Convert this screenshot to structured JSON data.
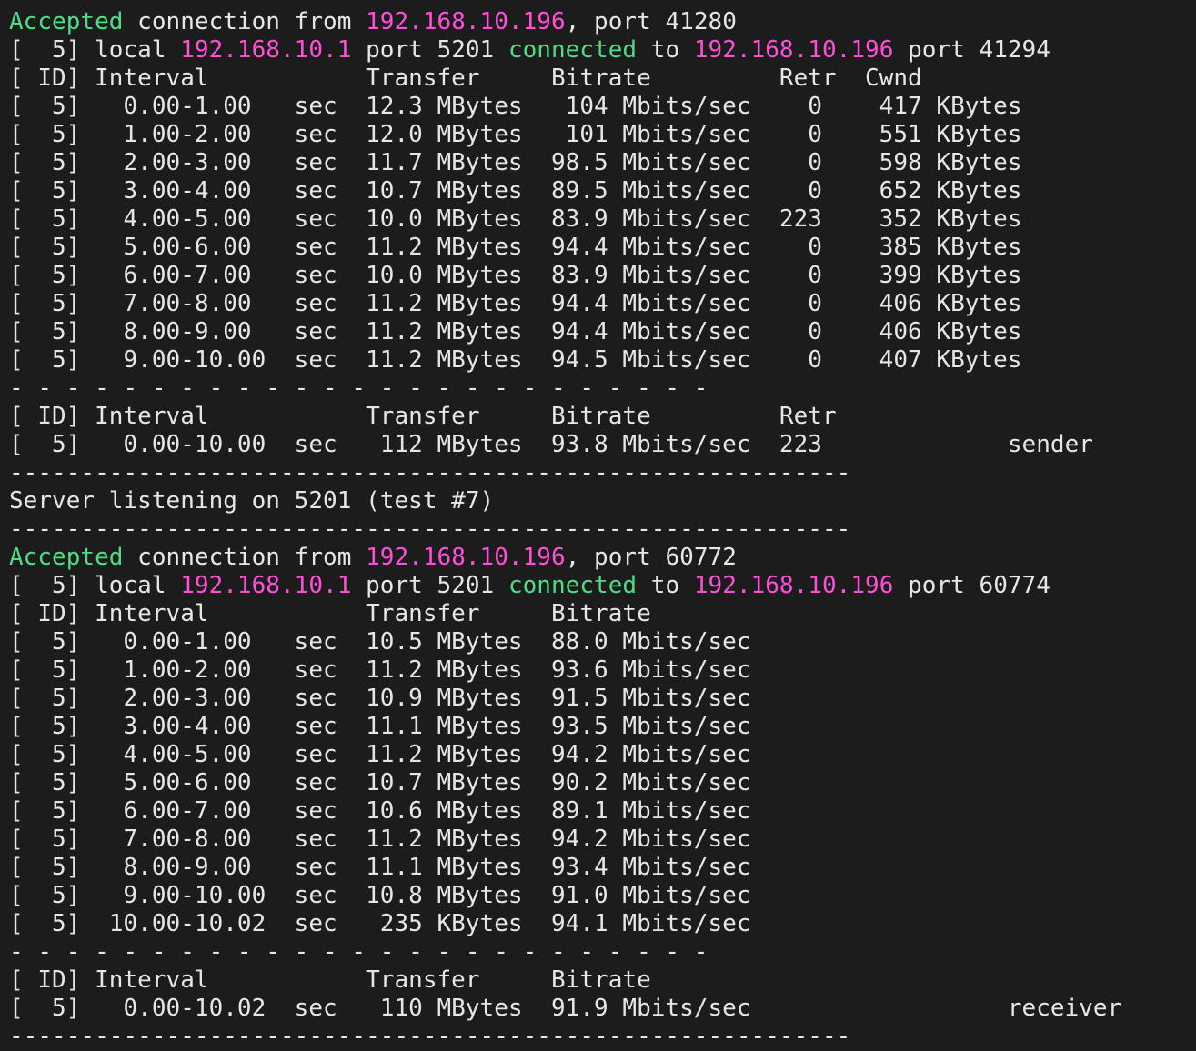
{
  "terminal": {
    "lines": [
      [
        [
          "g",
          "Accepted"
        ],
        [
          "w",
          " connection from "
        ],
        [
          "m",
          "192.168.10.196"
        ],
        [
          "w",
          ", port 41280"
        ]
      ],
      [
        [
          "w",
          "[  5] local "
        ],
        [
          "m",
          "192.168.10.1"
        ],
        [
          "w",
          " port 5201 "
        ],
        [
          "g",
          "connected"
        ],
        [
          "w",
          " to "
        ],
        [
          "m",
          "192.168.10.196"
        ],
        [
          "w",
          " port 41294"
        ]
      ],
      [
        [
          "w",
          "[ ID] Interval           Transfer     Bitrate         Retr  Cwnd"
        ]
      ],
      [
        [
          "w",
          "[  5]   0.00-1.00   sec  12.3 MBytes   104 Mbits/sec    0    417 KBytes"
        ]
      ],
      [
        [
          "w",
          "[  5]   1.00-2.00   sec  12.0 MBytes   101 Mbits/sec    0    551 KBytes"
        ]
      ],
      [
        [
          "w",
          "[  5]   2.00-3.00   sec  11.7 MBytes  98.5 Mbits/sec    0    598 KBytes"
        ]
      ],
      [
        [
          "w",
          "[  5]   3.00-4.00   sec  10.7 MBytes  89.5 Mbits/sec    0    652 KBytes"
        ]
      ],
      [
        [
          "w",
          "[  5]   4.00-5.00   sec  10.0 MBytes  83.9 Mbits/sec  223    352 KBytes"
        ]
      ],
      [
        [
          "w",
          "[  5]   5.00-6.00   sec  11.2 MBytes  94.4 Mbits/sec    0    385 KBytes"
        ]
      ],
      [
        [
          "w",
          "[  5]   6.00-7.00   sec  10.0 MBytes  83.9 Mbits/sec    0    399 KBytes"
        ]
      ],
      [
        [
          "w",
          "[  5]   7.00-8.00   sec  11.2 MBytes  94.4 Mbits/sec    0    406 KBytes"
        ]
      ],
      [
        [
          "w",
          "[  5]   8.00-9.00   sec  11.2 MBytes  94.4 Mbits/sec    0    406 KBytes"
        ]
      ],
      [
        [
          "w",
          "[  5]   9.00-10.00  sec  11.2 MBytes  94.5 Mbits/sec    0    407 KBytes"
        ]
      ],
      [
        [
          "w",
          "- - - - - - - - - - - - - - - - - - - - - - - - -"
        ]
      ],
      [
        [
          "w",
          "[ ID] Interval           Transfer     Bitrate         Retr"
        ]
      ],
      [
        [
          "w",
          "[  5]   0.00-10.00  sec   112 MBytes  93.8 Mbits/sec  223             sender"
        ]
      ],
      [
        [
          "w",
          "-----------------------------------------------------------"
        ]
      ],
      [
        [
          "w",
          "Server listening on 5201 (test #7)"
        ]
      ],
      [
        [
          "w",
          "-----------------------------------------------------------"
        ]
      ],
      [
        [
          "g",
          "Accepted"
        ],
        [
          "w",
          " connection from "
        ],
        [
          "m",
          "192.168.10.196"
        ],
        [
          "w",
          ", port 60772"
        ]
      ],
      [
        [
          "w",
          "[  5] local "
        ],
        [
          "m",
          "192.168.10.1"
        ],
        [
          "w",
          " port 5201 "
        ],
        [
          "g",
          "connected"
        ],
        [
          "w",
          " to "
        ],
        [
          "m",
          "192.168.10.196"
        ],
        [
          "w",
          " port 60774"
        ]
      ],
      [
        [
          "w",
          "[ ID] Interval           Transfer     Bitrate"
        ]
      ],
      [
        [
          "w",
          "[  5]   0.00-1.00   sec  10.5 MBytes  88.0 Mbits/sec"
        ]
      ],
      [
        [
          "w",
          "[  5]   1.00-2.00   sec  11.2 MBytes  93.6 Mbits/sec"
        ]
      ],
      [
        [
          "w",
          "[  5]   2.00-3.00   sec  10.9 MBytes  91.5 Mbits/sec"
        ]
      ],
      [
        [
          "w",
          "[  5]   3.00-4.00   sec  11.1 MBytes  93.5 Mbits/sec"
        ]
      ],
      [
        [
          "w",
          "[  5]   4.00-5.00   sec  11.2 MBytes  94.2 Mbits/sec"
        ]
      ],
      [
        [
          "w",
          "[  5]   5.00-6.00   sec  10.7 MBytes  90.2 Mbits/sec"
        ]
      ],
      [
        [
          "w",
          "[  5]   6.00-7.00   sec  10.6 MBytes  89.1 Mbits/sec"
        ]
      ],
      [
        [
          "w",
          "[  5]   7.00-8.00   sec  11.2 MBytes  94.2 Mbits/sec"
        ]
      ],
      [
        [
          "w",
          "[  5]   8.00-9.00   sec  11.1 MBytes  93.4 Mbits/sec"
        ]
      ],
      [
        [
          "w",
          "[  5]   9.00-10.00  sec  10.8 MBytes  91.0 Mbits/sec"
        ]
      ],
      [
        [
          "w",
          "[  5]  10.00-10.02  sec   235 KBytes  94.1 Mbits/sec"
        ]
      ],
      [
        [
          "w",
          "- - - - - - - - - - - - - - - - - - - - - - - - -"
        ]
      ],
      [
        [
          "w",
          "[ ID] Interval           Transfer     Bitrate"
        ]
      ],
      [
        [
          "w",
          "[  5]   0.00-10.02  sec   110 MBytes  91.9 Mbits/sec                  receiver"
        ]
      ],
      [
        [
          "w",
          "-----------------------------------------------------------"
        ]
      ]
    ],
    "colors": {
      "background": "#1c1c1c",
      "text": "#e6e6e6",
      "accepted_connected": "#4fdc84",
      "ip_address": "#ff4fd8"
    }
  }
}
